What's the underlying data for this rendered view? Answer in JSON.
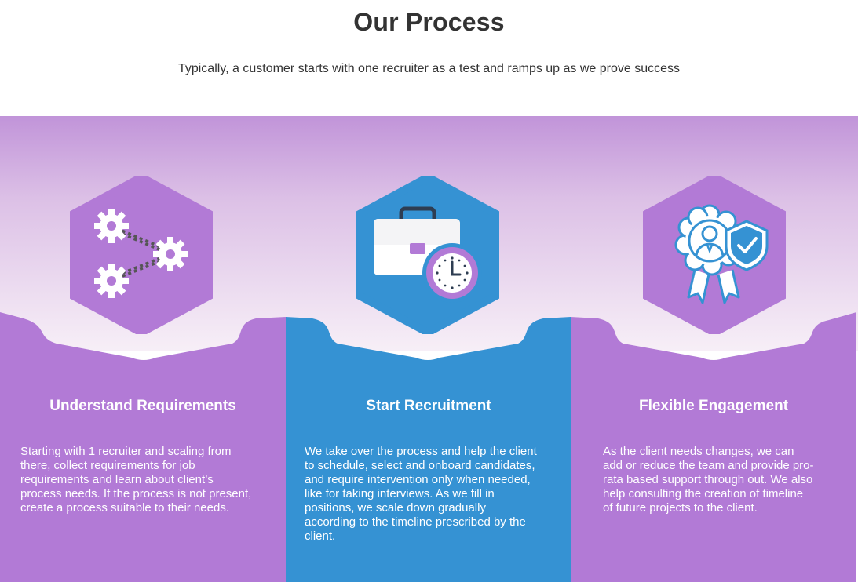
{
  "header": {
    "title": "Our Process",
    "subtitle": "Typically, a customer starts with one recruiter as a test and ramps up as we prove success"
  },
  "colors": {
    "purple": "#b27ad6",
    "blue": "#3592d3",
    "band_top": "#c59ad9",
    "band_bottom": "#f6eef7"
  },
  "steps": [
    {
      "icon": "gears-connected-icon",
      "title": "Understand Requirements",
      "text": "Starting with 1 recruiter and scaling from there, collect requirements for job requirements and learn about client’s process needs. If the process is not present, create a process suitable to their needs."
    },
    {
      "icon": "briefcase-clock-icon",
      "title": "Start Recruitment",
      "text": "We take over the process and help the client to schedule, select and onboard candidates, and require intervention only when needed, like for taking interviews. As we fill in positions, we scale down gradually according to the timeline prescribed by the client."
    },
    {
      "icon": "badge-shield-icon",
      "title": "Flexible Engagement",
      "text": "As the client needs changes, we can add or reduce the team and provide pro-rata based support through out. We also help consulting the creation of timeline of future projects to the client."
    }
  ]
}
